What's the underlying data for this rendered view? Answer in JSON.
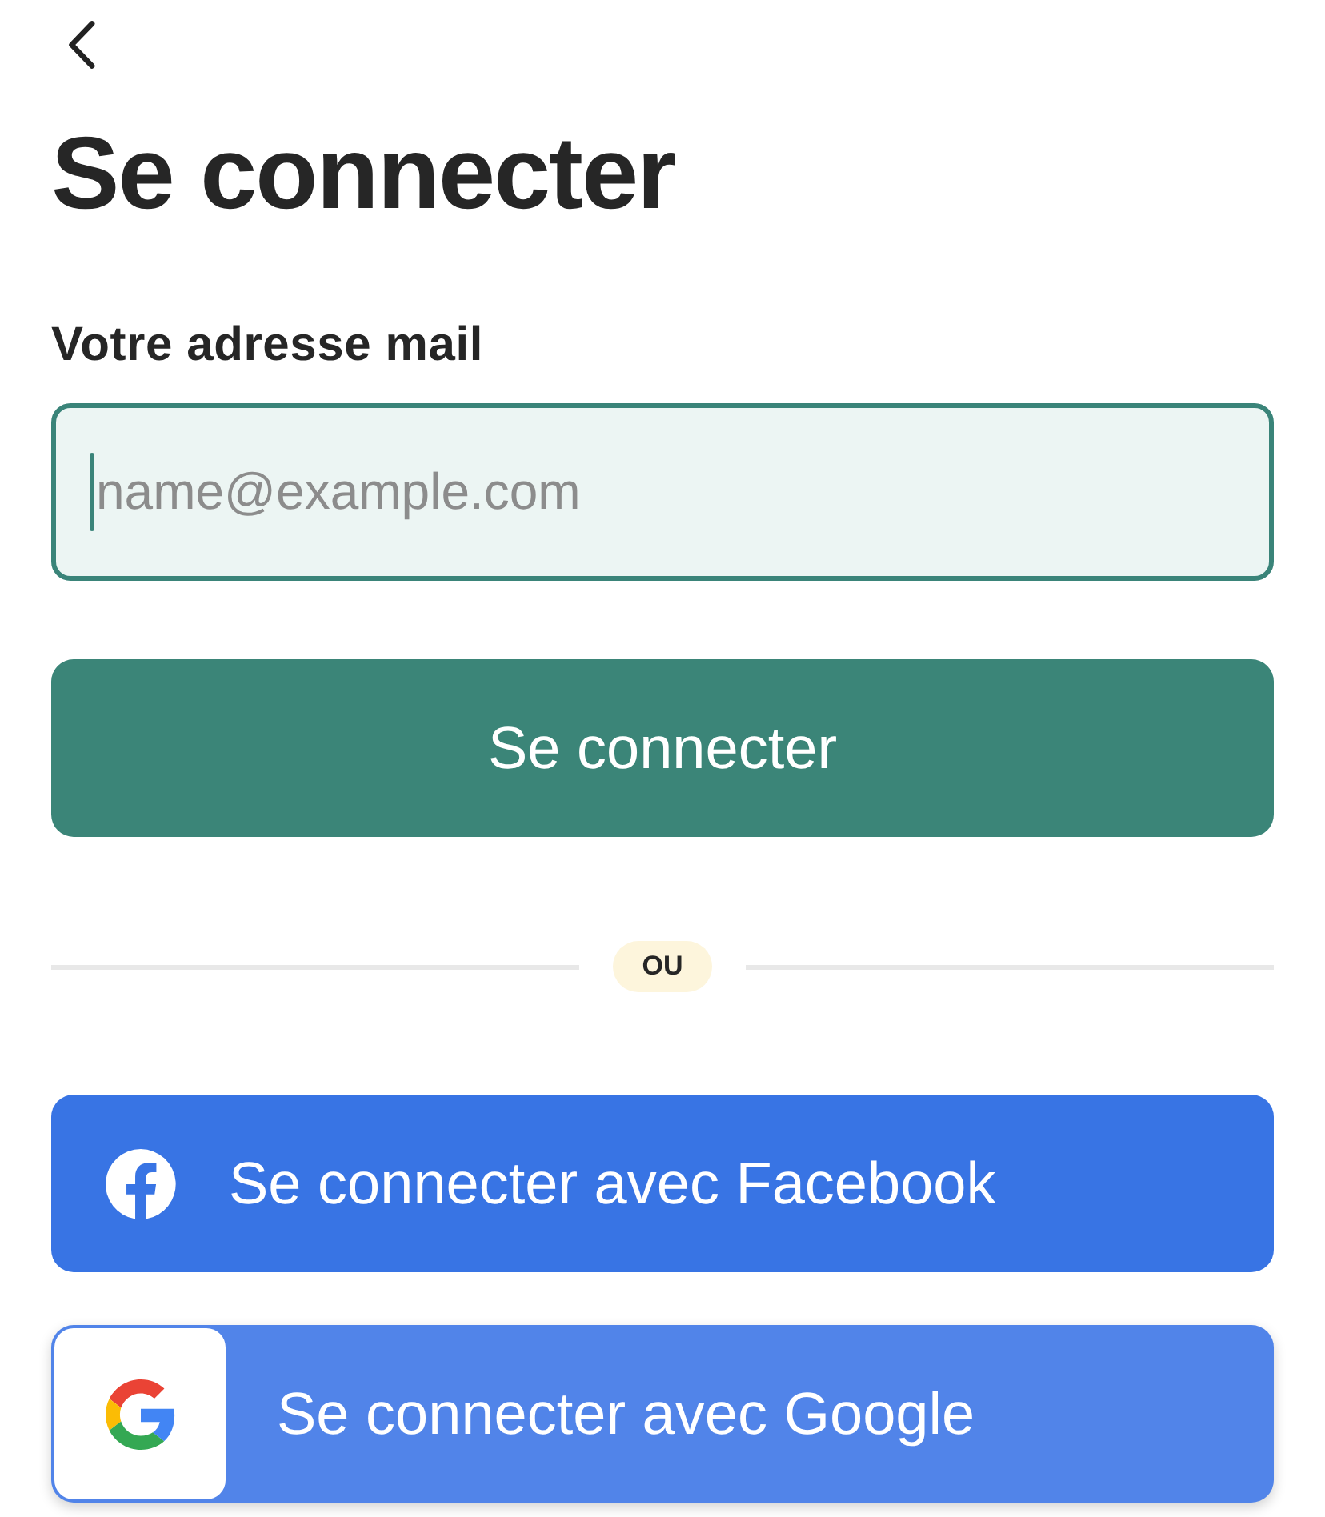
{
  "title": "Se connecter",
  "email_field": {
    "label": "Votre adresse mail",
    "placeholder": "name@example.com",
    "focused": true
  },
  "submit_button": {
    "label": "Se connecter"
  },
  "divider": {
    "label": "OU"
  },
  "social_buttons": [
    {
      "kind": "facebook",
      "label": "Se connecter avec Facebook"
    },
    {
      "kind": "google",
      "label": "Se connecter avec Google"
    }
  ]
}
